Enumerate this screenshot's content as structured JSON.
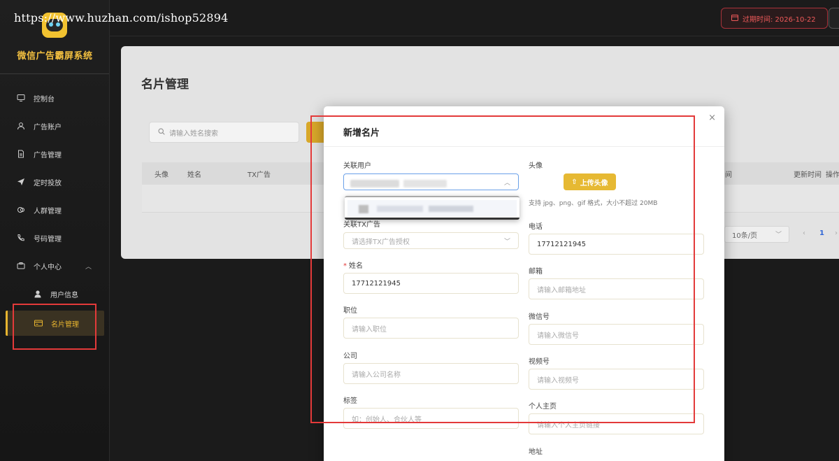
{
  "watermark": "https://www.huzhan.com/ishop52894",
  "brand": {
    "title": "微信广告霸屏系统"
  },
  "sidebar": {
    "items": [
      {
        "label": "控制台",
        "icon": "monitor-icon"
      },
      {
        "label": "广告账户",
        "icon": "user-icon"
      },
      {
        "label": "广告管理",
        "icon": "document-icon"
      },
      {
        "label": "定时投放",
        "icon": "send-icon"
      },
      {
        "label": "人群管理",
        "icon": "group-icon"
      },
      {
        "label": "号码管理",
        "icon": "phone-icon"
      },
      {
        "label": "个人中心",
        "icon": "profile-icon"
      },
      {
        "label": "用户信息",
        "icon": "person-icon"
      },
      {
        "label": "名片管理",
        "icon": "card-icon"
      }
    ],
    "active": "名片管理"
  },
  "topbar": {
    "expire": "过期时间: 2026-10-22"
  },
  "page": {
    "title": "名片管理",
    "search_placeholder": "请输入姓名搜索",
    "columns": [
      "头像",
      "姓名",
      "TX广告",
      "间",
      "更新时间",
      "操作"
    ],
    "page_size": "10条/页",
    "current_page": "1"
  },
  "modal": {
    "title": "新增名片",
    "close": "×",
    "fields": {
      "linked_user": {
        "label": "关联用户"
      },
      "linked_ad": {
        "label": "关联TX广告",
        "placeholder": "请选择TX广告授权"
      },
      "name": {
        "label": "姓名",
        "value": "17712121945"
      },
      "position": {
        "label": "职位",
        "placeholder": "请输入职位"
      },
      "company": {
        "label": "公司",
        "placeholder": "请输入公司名称"
      },
      "tags": {
        "label": "标签",
        "placeholder": "如：创始人、合伙人等"
      },
      "avatar": {
        "label": "头像",
        "upload": "上传头像",
        "hint": "支持 jpg、png、gif 格式，大小不超过 20MB"
      },
      "phone": {
        "label": "电话",
        "value": "17712121945"
      },
      "email": {
        "label": "邮箱",
        "placeholder": "请输入邮箱地址"
      },
      "wechat": {
        "label": "微信号",
        "placeholder": "请输入微信号"
      },
      "channel": {
        "label": "视频号",
        "placeholder": "请输入视频号"
      },
      "homepage": {
        "label": "个人主页",
        "placeholder": "请输入个人主页链接"
      },
      "address": {
        "label": "地址"
      }
    }
  }
}
